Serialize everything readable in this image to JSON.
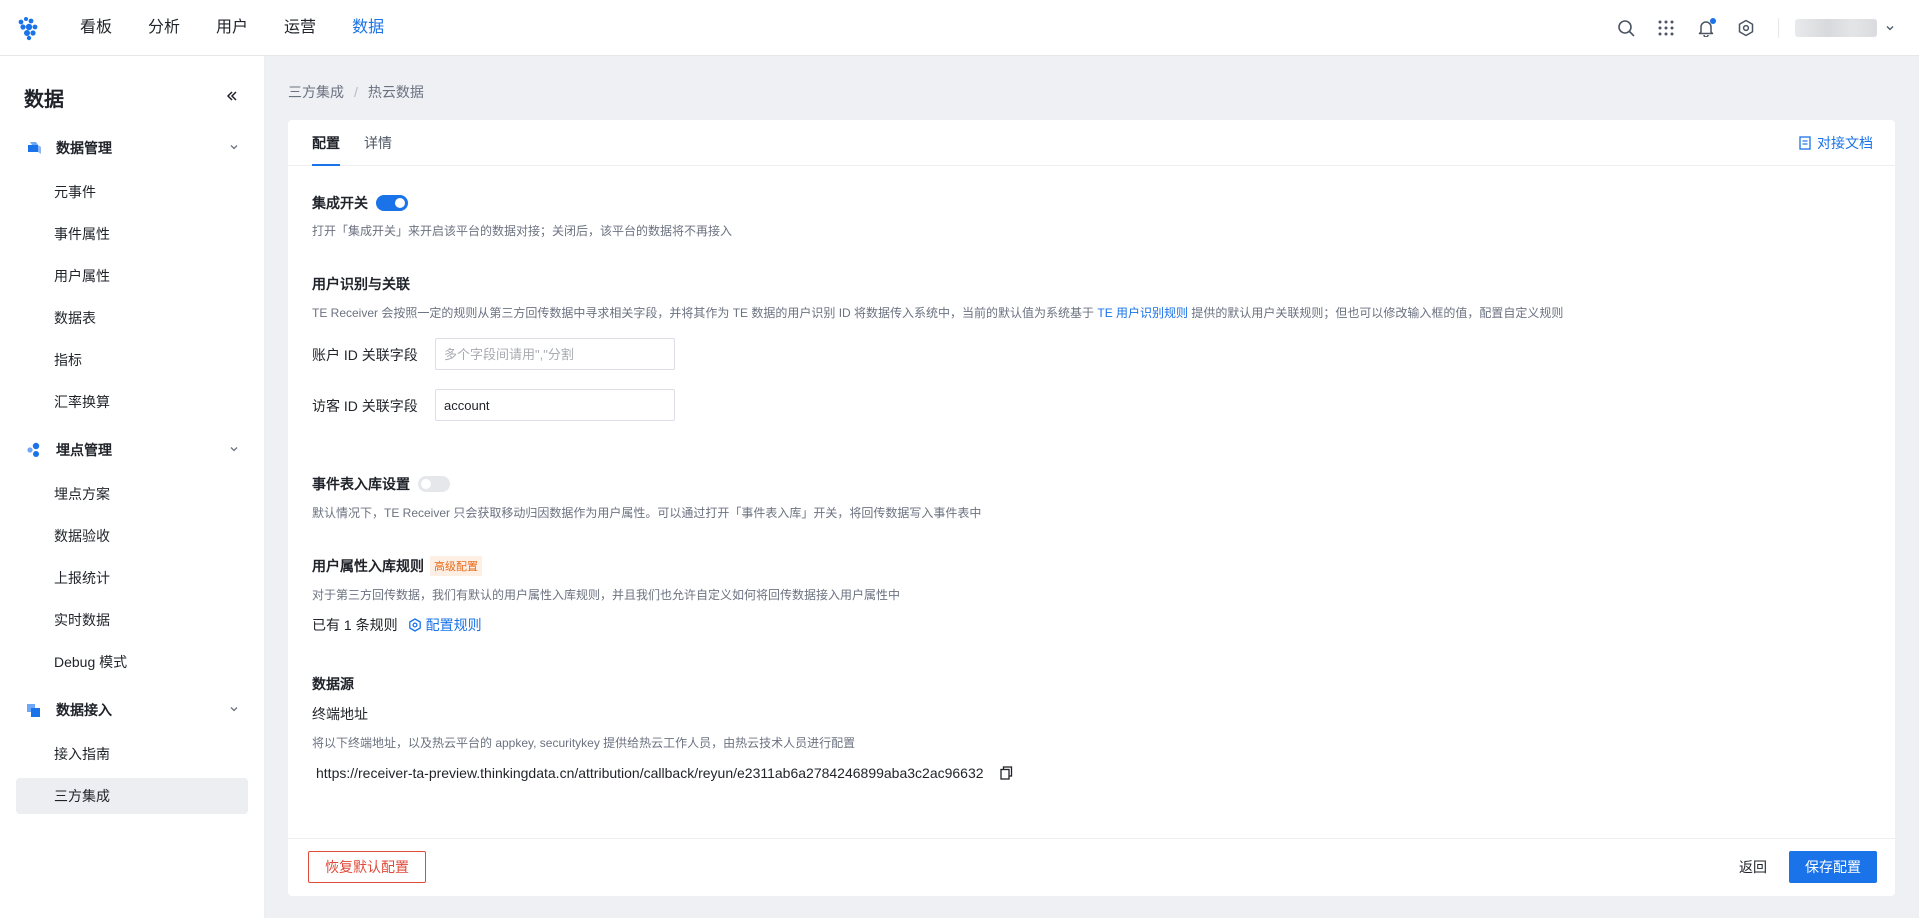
{
  "topnav": {
    "items": [
      {
        "label": "看板"
      },
      {
        "label": "分析"
      },
      {
        "label": "用户"
      },
      {
        "label": "运营"
      },
      {
        "label": "数据"
      }
    ],
    "active_index": 4,
    "accent_color": "#1a73e8",
    "icons": [
      "search-icon",
      "apps-grid-icon",
      "bell-icon",
      "settings-icon",
      "chevron-down-icon"
    ]
  },
  "sidebar": {
    "title": "数据",
    "groups": [
      {
        "label": "数据管理",
        "items": [
          "元事件",
          "事件属性",
          "用户属性",
          "数据表",
          "指标",
          "汇率换算"
        ]
      },
      {
        "label": "埋点管理",
        "items": [
          "埋点方案",
          "数据验收",
          "上报统计",
          "实时数据",
          "Debug 模式"
        ]
      },
      {
        "label": "数据接入",
        "items": [
          "接入指南",
          "三方集成"
        ]
      }
    ],
    "active_item": "三方集成"
  },
  "breadcrumb": [
    "三方集成",
    "热云数据"
  ],
  "tabs": {
    "items": [
      "配置",
      "详情"
    ],
    "active": "配置",
    "doc_link": "对接文档"
  },
  "integration_switch": {
    "title": "集成开关",
    "enabled": true,
    "desc": "打开「集成开关」来开启该平台的数据对接；关闭后，该平台的数据将不再接入"
  },
  "user_id": {
    "title": "用户识别与关联",
    "desc_before": "TE Receiver 会按照一定的规则从第三方回传数据中寻求相关字段，并将其作为 TE 数据的用户识别 ID 将数据传入系统中，当前的默认值为系统基于 ",
    "desc_link": "TE 用户识别规则",
    "desc_after": " 提供的默认用户关联规则；但也可以修改输入框的值，配置自定义规则",
    "account_label": "账户 ID 关联字段",
    "account_placeholder": "多个字段间请用\",\"分割",
    "account_value": "",
    "visitor_label": "访客 ID 关联字段",
    "visitor_value": "account"
  },
  "event_storage": {
    "title": "事件表入库设置",
    "enabled": false,
    "desc": "默认情况下，TE Receiver 只会获取移动归因数据作为用户属性。可以通过打开「事件表入库」开关，将回传数据写入事件表中"
  },
  "user_attr_rules": {
    "title": "用户属性入库规则",
    "badge": "高级配置",
    "desc": "对于第三方回传数据，我们有默认的用户属性入库规则，并且我们也允许自定义如何将回传数据接入用户属性中",
    "rules_text": "已有 1 条规则",
    "config_link": "配置规则"
  },
  "datasource": {
    "title": "数据源",
    "endpoint_label": "终端地址",
    "desc": "将以下终端地址，以及热云平台的 appkey, securitykey 提供给热云工作人员，由热云技术人员进行配置",
    "url": "https://receiver-ta-preview.thinkingdata.cn/attribution/callback/reyun/e2311ab6a2784246899aba3c2ac96632"
  },
  "footer": {
    "reset": "恢复默认配置",
    "back": "返回",
    "save": "保存配置"
  }
}
